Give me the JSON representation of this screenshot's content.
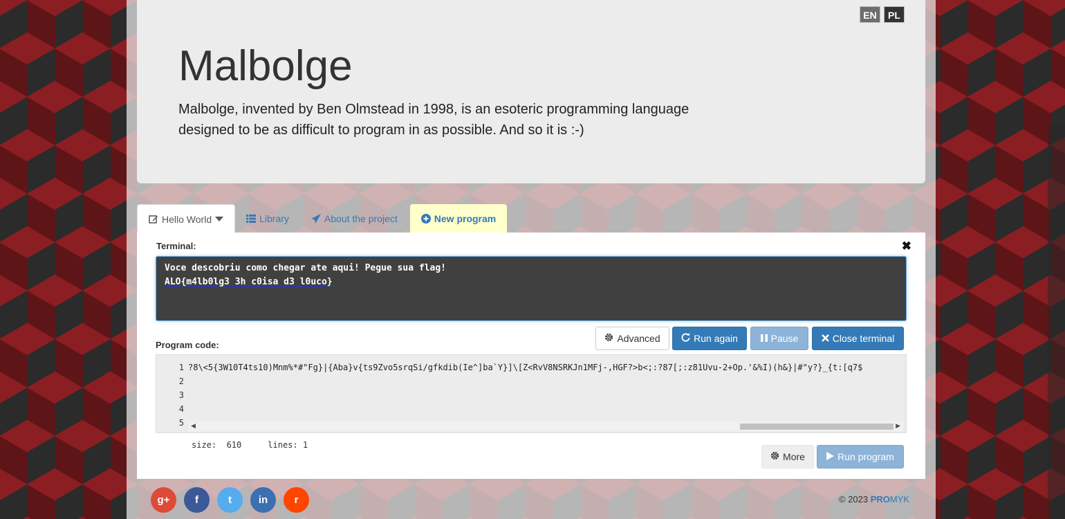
{
  "header": {
    "title": "Malbolge",
    "lead_line1": "Malbolge, invented by Ben Olmstead in 1998, is an esoteric programming language",
    "lead_line2": "designed to be as difficult to program in as possible. And so it is :-)",
    "languages": [
      "EN",
      "PL"
    ]
  },
  "tabs": [
    {
      "label": "Hello World",
      "icon": "edit-icon",
      "active": true
    },
    {
      "label": "Library",
      "icon": "list-icon"
    },
    {
      "label": "About the project",
      "icon": "send-icon"
    },
    {
      "label": "New program",
      "icon": "plus-circle-icon"
    }
  ],
  "terminal": {
    "label": "Terminal:",
    "line1": "Voce descobriu como chegar ate aqui! Pegue sua flag!",
    "line2": "ALO{m4lb0lg3 3h c0isa d3 l0uco}"
  },
  "buttons": {
    "advanced": "Advanced",
    "run_again": "Run again",
    "pause": "Pause",
    "close_terminal": "Close terminal",
    "more": "More",
    "run_program": "Run program"
  },
  "editor": {
    "label": "Program code:",
    "line_numbers": [
      "1",
      "2",
      "3",
      "4",
      "5"
    ],
    "code_line": "?8\\<5{3W10T4ts10)Mnm%*#\"Fg}|{Aba}v{ts9Zvo5srqSi/gfkdib(Ie^]ba`Y}]\\[Z<RvV8NSRKJn1MFj-,HGF?>b<;:?87[;:z81Uvu-2+Op.'&%I)(h&}|#\"y?}_{t:[q7$"
  },
  "stats": {
    "size_label": "size:",
    "size_value": "610",
    "lines_label": "lines:",
    "lines_value": "1"
  },
  "footer": {
    "social": [
      {
        "label": "g+",
        "color": "#dd4b39"
      },
      {
        "label": "f",
        "color": "#3b5998"
      },
      {
        "label": "t",
        "color": "#55acee"
      },
      {
        "label": "in",
        "color": "#3b70b1"
      },
      {
        "label": "r",
        "color": "#ff4500"
      }
    ],
    "copyright": "© 2023",
    "brand_bold": "PRO",
    "brand_rest": "MYK"
  },
  "colors": {
    "accent": "#337ab7",
    "terminal_bg": "#404040",
    "new_tab_bg": "#ffffcc"
  }
}
